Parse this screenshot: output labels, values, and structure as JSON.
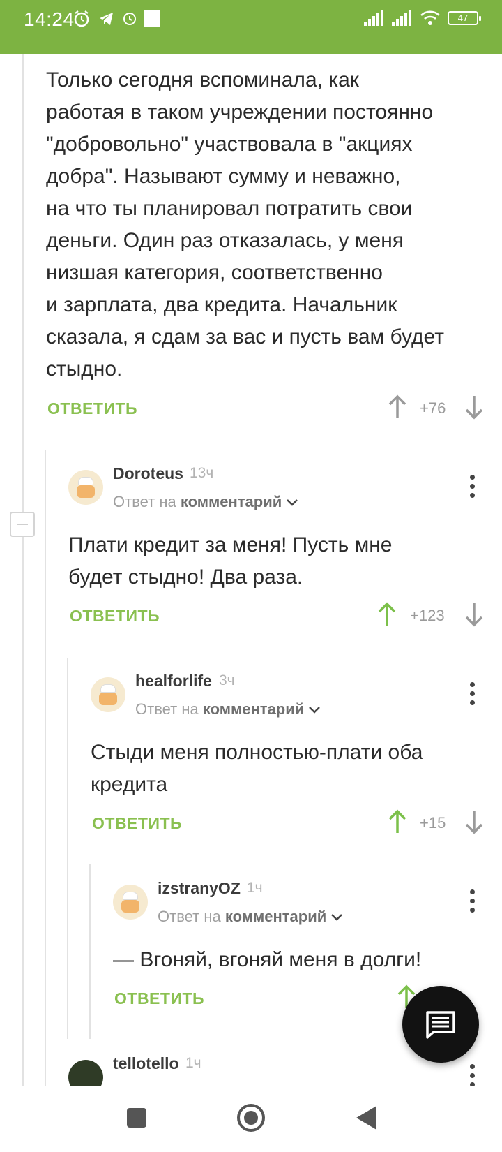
{
  "status_bar": {
    "time": "14:24",
    "battery": "47"
  },
  "comments": [
    {
      "text_lines": [
        "Только сегодня вспоминала, как",
        "работая в таком учреждении постоянно",
        "\"добровольно\" участвовала в \"акциях",
        "добра\". Называют сумму и неважно,",
        "на что ты планировал потратить свои",
        "деньги. Один раз отказалась, у меня",
        "низшая категория, соответственно",
        "и зарплата, два кредита. Начальник",
        "сказала, я сдам за вас и пусть вам будет",
        "стыдно."
      ],
      "reply_label": "ОТВЕТИТЬ",
      "score": "+76",
      "upvoted": false
    },
    {
      "author": "Doroteus",
      "time": "13ч",
      "reply_to_prefix": "Ответ на",
      "reply_to_link": "комментарий",
      "text_lines": [
        "Плати кредит за меня! Пусть мне",
        "будет стыдно! Два раза."
      ],
      "reply_label": "ОТВЕТИТЬ",
      "score": "+123",
      "upvoted": true
    },
    {
      "author": "healforlife",
      "time": "3ч",
      "reply_to_prefix": "Ответ на",
      "reply_to_link": "комментарий",
      "text_lines": [
        "Стыди меня полностью-плати оба",
        "кредита"
      ],
      "reply_label": "ОТВЕТИТЬ",
      "score": "+15",
      "upvoted": true
    },
    {
      "author": "izstranyOZ",
      "time": "1ч",
      "reply_to_prefix": "Ответ на",
      "reply_to_link": "комментарий",
      "text_lines": [
        "— Вгоняй, вгоняй меня в долги!"
      ],
      "reply_label": "ОТВЕТИТЬ",
      "upvoted": true
    },
    {
      "author": "tellotello",
      "time": "1ч"
    }
  ],
  "colors": {
    "accent": "#7db342",
    "reply": "#8ac050",
    "upvote": "#7cc04a"
  }
}
